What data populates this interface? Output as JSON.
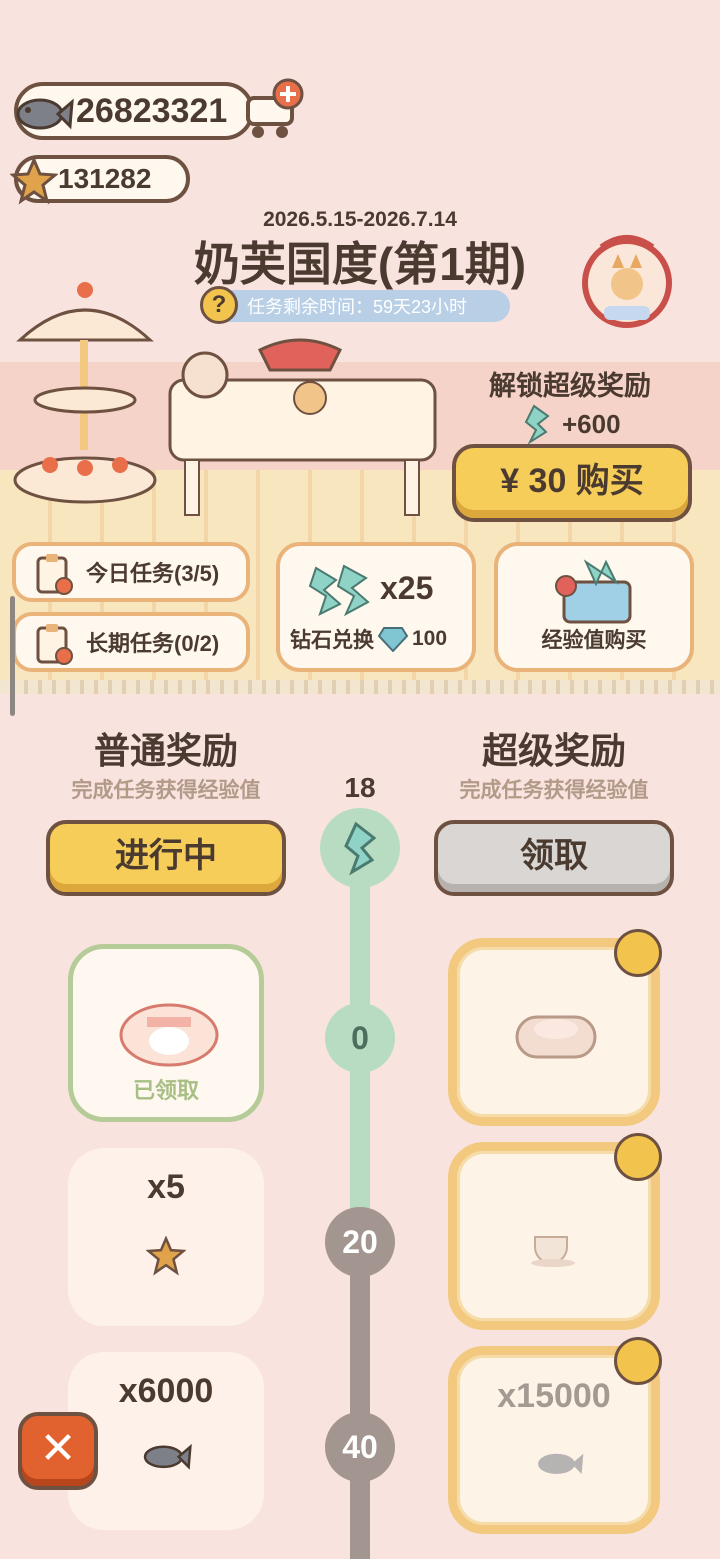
{
  "currency": {
    "fish": "26823321",
    "stars": "131282"
  },
  "header": {
    "date_range": "2026.5.15-2026.7.14",
    "title": "奶芙国度(第1期)",
    "timer_label": "任务剩余时间：59天23小时",
    "help_symbol": "?"
  },
  "unlock": {
    "label": "解锁超级奖励",
    "amount": "+600",
    "buy_label": "¥ 30 购买"
  },
  "tasks": {
    "daily": "今日任务(3/5)",
    "long_term": "长期任务(0/2)"
  },
  "diamond_exchange": {
    "qty": "x25",
    "label": "钻石兑换",
    "cost": "100"
  },
  "exp_purchase": {
    "label": "经验值购买"
  },
  "rewards": {
    "normal_title": "普通奖励",
    "normal_sub": "完成任务获得经验值",
    "super_title": "超级奖励",
    "super_sub": "完成任务获得经验值",
    "level": "18",
    "progress_label": "进行中",
    "claim_label": "领取",
    "nodes": [
      "0",
      "20",
      "40"
    ],
    "free": [
      {
        "count": "",
        "status": "已领取",
        "claimed": true,
        "icon": "cat-bed-icon"
      },
      {
        "count": "x5",
        "icon": "star-icon"
      },
      {
        "count": "x6000",
        "icon": "fish-icon"
      }
    ],
    "super": [
      {
        "count": "",
        "icon": "cat-bed-icon",
        "locked": true
      },
      {
        "count": "",
        "icon": "teacup-icon",
        "locked": true
      },
      {
        "count": "x15000",
        "icon": "fish-icon",
        "locked": true
      }
    ]
  },
  "close_symbol": "✕"
}
